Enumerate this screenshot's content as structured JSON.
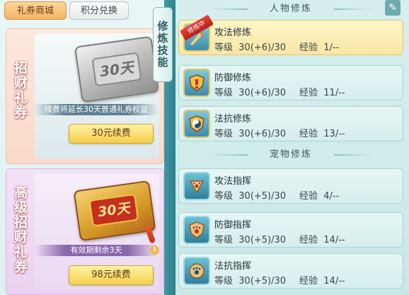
{
  "top_tabs": [
    {
      "label": "礼券商城",
      "active": true
    },
    {
      "label": "积分兑换",
      "active": false
    }
  ],
  "left_panel": {
    "card1": {
      "side_title": "招财礼券",
      "ticket_text": "30天",
      "info": "续费将延长30天普通礼券权益",
      "renew_label": "30元续费"
    },
    "card2": {
      "side_title": "高级招财礼券",
      "ticket_text": "30天",
      "info": "有效期剩余3天",
      "info_icon": "i",
      "renew_label": "98元续费"
    }
  },
  "vertical_tab": {
    "label": "修炼技能"
  },
  "right_panel": {
    "header_character": "人物修炼",
    "header_pet": "宠物修炼",
    "edit_icon": "edit-icon",
    "level_label": "等级",
    "exp_label": "经验",
    "character_skills": [
      {
        "name": "攻法修炼",
        "level": "30(+6)/30",
        "exp": "1/--",
        "badge": "修炼中",
        "icon": "sword-fire-icon"
      },
      {
        "name": "防御修炼",
        "level": "30(+6)/30",
        "exp": "11/--",
        "icon": "shield-icon"
      },
      {
        "name": "法抗修炼",
        "level": "30(+6)/30",
        "exp": "13/--",
        "icon": "yin-yang-shield-icon"
      }
    ],
    "pet_skills": [
      {
        "name": "攻法指挥",
        "level": "30(+5)/30",
        "exp": "4/--",
        "icon": "paw-triangle-icon"
      },
      {
        "name": "防御指挥",
        "level": "30(+5)/30",
        "exp": "14/--",
        "icon": "paw-shield-icon"
      },
      {
        "name": "法抗指挥",
        "level": "30(+5)/30",
        "exp": "14/--",
        "icon": "paw-circle-icon"
      }
    ]
  },
  "colors": {
    "accent_gold": "#f5cf4a",
    "panel_teal": "#2e7f8d",
    "active_row": "#fff6c8"
  }
}
